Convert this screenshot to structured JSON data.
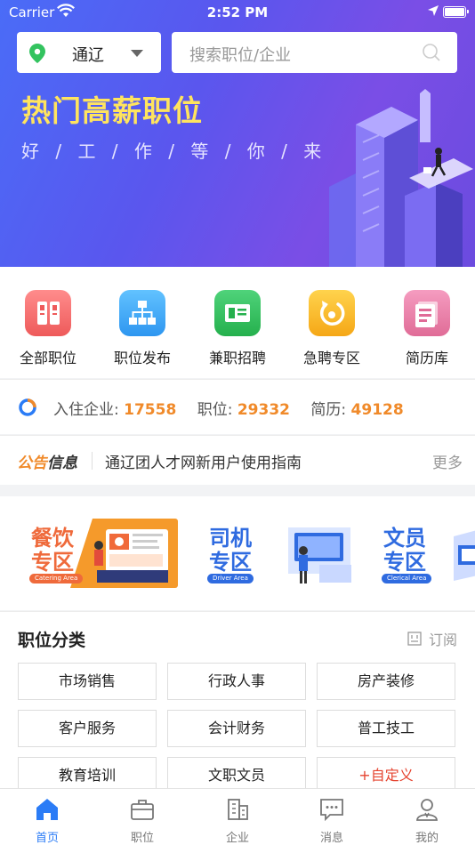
{
  "status_bar": {
    "carrier": "Carrier",
    "time": "2:52 PM"
  },
  "header": {
    "city": "通辽",
    "search_placeholder": "搜索职位/企业"
  },
  "hero": {
    "title": "热门高薪职位",
    "subtitle": "好 / 工 / 作 / 等 / 你 / 来"
  },
  "quick_links": [
    {
      "label": "全部职位",
      "icon": "job-list-icon",
      "color": "#f26d6d"
    },
    {
      "label": "职位发布",
      "icon": "org-chart-icon",
      "color": "#3ea6f5"
    },
    {
      "label": "兼职招聘",
      "icon": "part-time-icon",
      "color": "#33c35f"
    },
    {
      "label": "急聘专区",
      "icon": "urgent-icon",
      "color": "#f7b824"
    },
    {
      "label": "简历库",
      "icon": "resume-icon",
      "color": "#e97da6"
    }
  ],
  "stats": {
    "companies_label": "入住企业:",
    "companies": "17558",
    "jobs_label": "职位:",
    "jobs": "29332",
    "resumes_label": "简历:",
    "resumes": "49128"
  },
  "notice": {
    "tag_part1": "公告",
    "tag_part2": "信息",
    "text": "通辽团人才网新用户使用指南",
    "more": "更多"
  },
  "banners": [
    {
      "title": "餐饮\n专区",
      "line1": "餐饮",
      "line2": "专区",
      "tag": "Catering Area",
      "color": "#ef6a3b"
    },
    {
      "title": "司机\n专区",
      "line1": "司机",
      "line2": "专区",
      "tag": "Driver Area",
      "color": "#2f6be0"
    },
    {
      "title": "文员\n专区",
      "line1": "文员",
      "line2": "专区",
      "tag": "Clerical Area",
      "color": "#2f6be0"
    }
  ],
  "categories": {
    "title": "职位分类",
    "subscribe": "订阅",
    "items": [
      "市场销售",
      "行政人事",
      "房产装修",
      "客户服务",
      "会计财务",
      "普工技工",
      "教育培训",
      "文职文员",
      "+自定义"
    ]
  },
  "tabbar": [
    {
      "label": "首页",
      "icon": "home-icon",
      "active": true
    },
    {
      "label": "职位",
      "icon": "briefcase-icon",
      "active": false
    },
    {
      "label": "企业",
      "icon": "building-icon",
      "active": false
    },
    {
      "label": "消息",
      "icon": "message-icon",
      "active": false
    },
    {
      "label": "我的",
      "icon": "profile-icon",
      "active": false
    }
  ],
  "colors": {
    "accent": "#2b7cf6",
    "highlight": "#f08a2a",
    "hero_title": "#ffe45e"
  }
}
